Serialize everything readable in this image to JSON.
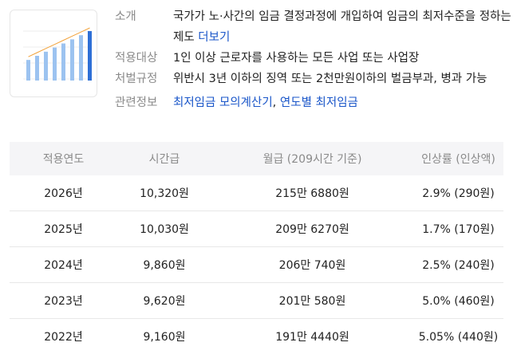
{
  "thumbnail": {
    "alt": "minimum wage chart",
    "bar_values": [
      5,
      6,
      7,
      8,
      9,
      10,
      11,
      12
    ],
    "bar_color": "#2e6fd6",
    "bar_light": "#9cc3f0"
  },
  "info": {
    "rows": [
      {
        "key": "소개",
        "value": "국가가 노·사간의 임금 결정과정에 개입하여 임금의 최저수준을 정하는 제도",
        "link": "더보기"
      },
      {
        "key": "적용대상",
        "value": "1인 이상 근로자를 사용하는 모든 사업 또는 사업장"
      },
      {
        "key": "처벌규정",
        "value": "위반시 3년 이하의 징역 또는 2천만원이하의 벌금부과, 병과 가능"
      },
      {
        "key": "관련정보",
        "links": [
          "최저임금 모의계산기",
          "연도별 최저임금"
        ],
        "separator": ", "
      }
    ]
  },
  "table": {
    "headers": [
      "적용연도",
      "시간급",
      "월급 (209시간 기준)",
      "인상률 (인상액)"
    ],
    "rows": [
      [
        "2026년",
        "10,320원",
        "215만 6880원",
        "2.9% (290원)"
      ],
      [
        "2025년",
        "10,030원",
        "209만 6270원",
        "1.7% (170원)"
      ],
      [
        "2024년",
        "9,860원",
        "206만 740원",
        "2.5% (240원)"
      ],
      [
        "2023년",
        "9,620원",
        "201만 580원",
        "5.0% (460원)"
      ],
      [
        "2022년",
        "9,160원",
        "191만 4440원",
        "5.05% (440원)"
      ]
    ]
  }
}
